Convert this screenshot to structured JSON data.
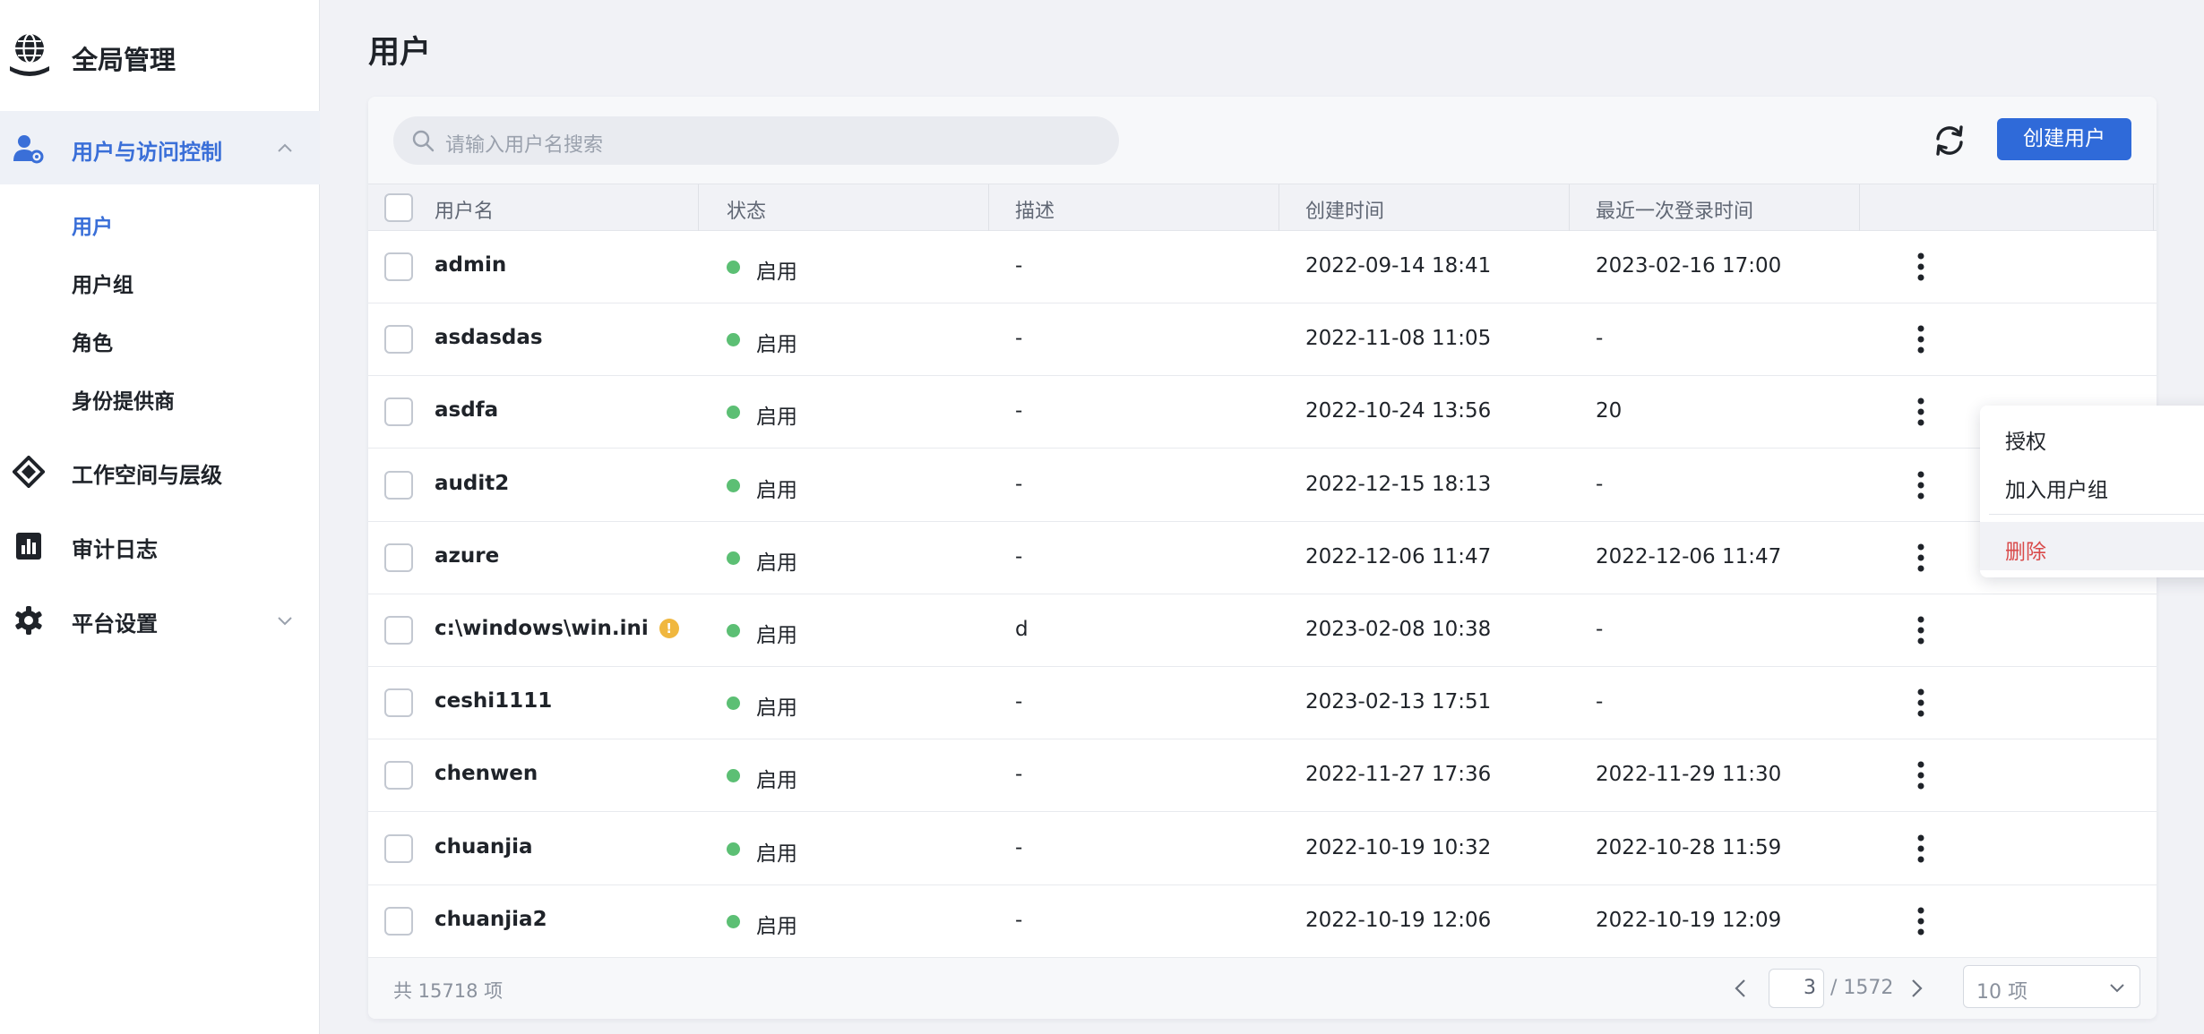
{
  "app": {
    "title": "全局管理"
  },
  "sidebar": {
    "groups": [
      {
        "label": "用户与访问控制",
        "icon": "user-gear-icon",
        "expanded": true
      },
      {
        "label": "工作空间与层级",
        "icon": "layers-icon"
      },
      {
        "label": "审计日志",
        "icon": "chart-icon"
      },
      {
        "label": "平台设置",
        "icon": "gear-icon",
        "expanded": false
      }
    ],
    "sub_items": [
      "用户",
      "用户组",
      "角色",
      "身份提供商"
    ]
  },
  "page": {
    "title": "用户"
  },
  "search": {
    "placeholder": "请输入用户名搜索"
  },
  "toolbar": {
    "create_label": "创建用户"
  },
  "table": {
    "headers": [
      "用户名",
      "状态",
      "描述",
      "创建时间",
      "最近一次登录时间"
    ],
    "rows": [
      {
        "name": "admin",
        "status": "启用",
        "desc": "-",
        "created": "2022-09-14 18:41",
        "last": "2023-02-16 17:00"
      },
      {
        "name": "asdasdas",
        "status": "启用",
        "desc": "-",
        "created": "2022-11-08 11:05",
        "last": "-"
      },
      {
        "name": "asdfa",
        "status": "启用",
        "desc": "-",
        "created": "2022-10-24 13:56",
        "last": "20"
      },
      {
        "name": "audit2",
        "status": "启用",
        "desc": "-",
        "created": "2022-12-15 18:13",
        "last": "-"
      },
      {
        "name": "azure",
        "status": "启用",
        "desc": "-",
        "created": "2022-12-06 11:47",
        "last": "2022-12-06 11:47"
      },
      {
        "name": "c:\\windows\\win.ini",
        "status": "启用",
        "desc": "d",
        "created": "2023-02-08 10:38",
        "last": "-",
        "warning": "!"
      },
      {
        "name": "ceshi1111",
        "status": "启用",
        "desc": "-",
        "created": "2023-02-13 17:51",
        "last": "-"
      },
      {
        "name": "chenwen",
        "status": "启用",
        "desc": "-",
        "created": "2022-11-27 17:36",
        "last": "2022-11-29 11:30"
      },
      {
        "name": "chuanjia",
        "status": "启用",
        "desc": "-",
        "created": "2022-10-19 10:32",
        "last": "2022-10-28 11:59"
      },
      {
        "name": "chuanjia2",
        "status": "启用",
        "desc": "-",
        "created": "2022-10-19 12:06",
        "last": "2022-10-19 12:09"
      }
    ]
  },
  "context_menu": {
    "items": [
      "授权",
      "加入用户组"
    ],
    "danger": "删除"
  },
  "pagination": {
    "total": "共 15718 项",
    "page": "3",
    "page_total": "/ 1572",
    "page_size": "10 项"
  },
  "colors": {
    "accent": "#2f6ad9",
    "active_text": "#3a6fd8",
    "status_enabled": "#5cbf74",
    "danger": "#d94a4a",
    "warning": "#f0b73f"
  }
}
